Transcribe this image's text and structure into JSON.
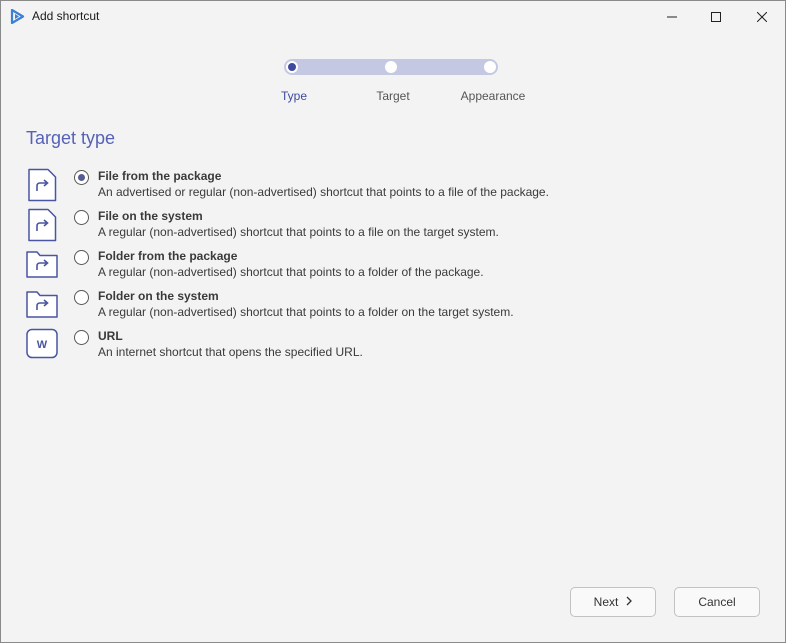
{
  "window": {
    "title": "Add shortcut"
  },
  "wizard": {
    "steps": [
      {
        "label": "Type",
        "active": true
      },
      {
        "label": "Target",
        "active": false
      },
      {
        "label": "Appearance",
        "active": false
      }
    ]
  },
  "section_title": "Target type",
  "options": [
    {
      "title": "File from the package",
      "description": "An advertised or regular (non-advertised) shortcut that points to a file of the package.",
      "icon": "file-shortcut-icon",
      "selected": true
    },
    {
      "title": "File on the system",
      "description": "A regular (non-advertised) shortcut that points to a file on the target system.",
      "icon": "file-shortcut-icon",
      "selected": false
    },
    {
      "title": "Folder from the package",
      "description": "A regular (non-advertised) shortcut that points to a folder of the package.",
      "icon": "folder-shortcut-icon",
      "selected": false
    },
    {
      "title": "Folder on the system",
      "description": "A regular (non-advertised) shortcut that points to a folder on the target system.",
      "icon": "folder-shortcut-icon",
      "selected": false
    },
    {
      "title": "URL",
      "description": "An internet shortcut that opens the specified URL.",
      "icon": "url-shortcut-icon",
      "icon_letter": "W",
      "selected": false
    }
  ],
  "buttons": {
    "next_label": "Next",
    "cancel_label": "Cancel"
  },
  "colors": {
    "accent": "#5661b8",
    "stepper_track": "#c5c8e3",
    "icon_stroke": "#4a55a2"
  }
}
